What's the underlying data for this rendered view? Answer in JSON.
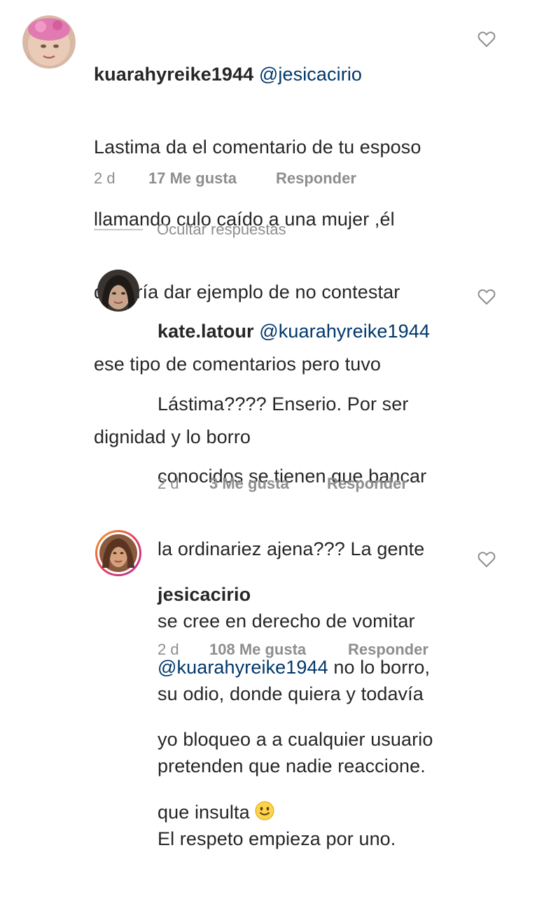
{
  "comments": [
    {
      "username": "kuarahyreike1944",
      "mention": "@jesicacirio",
      "lines": [
        "Lastima da el comentario de tu esposo",
        "llamando culo caído a una mujer ,él",
        "debería dar ejemplo de no contestar",
        "ese tipo de comentarios pero tuvo",
        "dignidad y lo borro"
      ],
      "time": "2 d",
      "likes": "17 Me gusta",
      "reply": "Responder"
    },
    {
      "username": "kate.latour",
      "mention": "@kuarahyreike1944",
      "lines": [
        "Lástima???? Enserio. Por ser",
        "conocidos se tienen que bancar",
        "la ordinariez ajena??? La gente",
        "se cree en derecho de vomitar",
        "su odio, donde quiera y todavía",
        "pretenden que nadie reaccione.",
        "El respeto empieza por uno."
      ],
      "time": "2 d",
      "likes": "3 Me gusta",
      "reply": "Responder"
    },
    {
      "username": "jesicacirio",
      "mention": "@kuarahyreike1944",
      "lines": [
        " no lo borro,",
        "yo bloqueo a a cualquier usuario",
        "que insulta "
      ],
      "emoji": "slightly-smiling-face",
      "time": "2 d",
      "likes": "108 Me gusta",
      "reply": "Responder"
    }
  ],
  "hide_replies": "Ocultar respuestas",
  "icons": {
    "like": "heart-outline-icon"
  },
  "colors": {
    "text": "#262626",
    "mention": "#00376b",
    "meta": "#8e8e8e"
  }
}
